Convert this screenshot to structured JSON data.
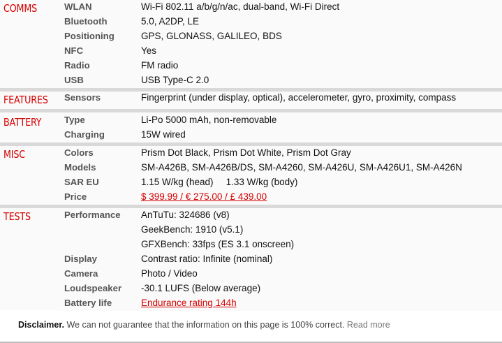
{
  "sections": {
    "comms": {
      "title": "COMMS",
      "rows": [
        {
          "label": "WLAN",
          "value": "Wi-Fi 802.11 a/b/g/n/ac, dual-band, Wi-Fi Direct"
        },
        {
          "label": "Bluetooth",
          "value": "5.0, A2DP, LE"
        },
        {
          "label": "Positioning",
          "value": "GPS, GLONASS, GALILEO, BDS"
        },
        {
          "label": "NFC",
          "value": "Yes"
        },
        {
          "label": "Radio",
          "value": "FM radio"
        },
        {
          "label": "USB",
          "value": "USB Type-C 2.0"
        }
      ]
    },
    "features": {
      "title": "FEATURES",
      "rows": [
        {
          "label": "Sensors",
          "value": "Fingerprint (under display, optical), accelerometer, gyro, proximity, compass"
        }
      ]
    },
    "battery": {
      "title": "BATTERY",
      "rows": [
        {
          "label": "Type",
          "value": "Li-Po 5000 mAh, non-removable"
        },
        {
          "label": "Charging",
          "value": "15W wired"
        }
      ]
    },
    "misc": {
      "title": "MISC",
      "rows": [
        {
          "label": "Colors",
          "value": "Prism Dot Black, Prism Dot White, Prism Dot Gray"
        },
        {
          "label": "Models",
          "value": "SM-A426B, SM-A426B/DS, SM-A4260, SM-A426U, SM-A426U1, SM-A426N"
        },
        {
          "label": "SAR EU",
          "value_head": "1.15 W/kg (head)",
          "value_body": "1.33 W/kg (body)"
        },
        {
          "label": "Price",
          "value_link": "$ 399.99 / € 275.00 / £ 439.00"
        }
      ]
    },
    "tests": {
      "title": "TESTS",
      "rows": [
        {
          "label": "Performance",
          "value": "AnTuTu: 324686 (v8)"
        },
        {
          "label": "",
          "value": "GeekBench: 1910 (v5.1)"
        },
        {
          "label": "",
          "value": "GFXBench: 33fps (ES 3.1 onscreen)"
        },
        {
          "label": "Display",
          "value": "Contrast ratio: Infinite (nominal)"
        },
        {
          "label": "Camera",
          "value": "Photo / Video"
        },
        {
          "label": "Loudspeaker",
          "value": "-30.1 LUFS (Below average)"
        },
        {
          "label": "Battery life",
          "value_link": "Endurance rating 144h"
        }
      ]
    }
  },
  "disclaimer": {
    "bold": "Disclaimer.",
    "text": " We can not guarantee that the information on this page is 100% correct. ",
    "more": "Read more"
  },
  "colors": {
    "accent": "#d50000",
    "row_bg": "#fafafa",
    "separator": "#d9d9d9"
  }
}
